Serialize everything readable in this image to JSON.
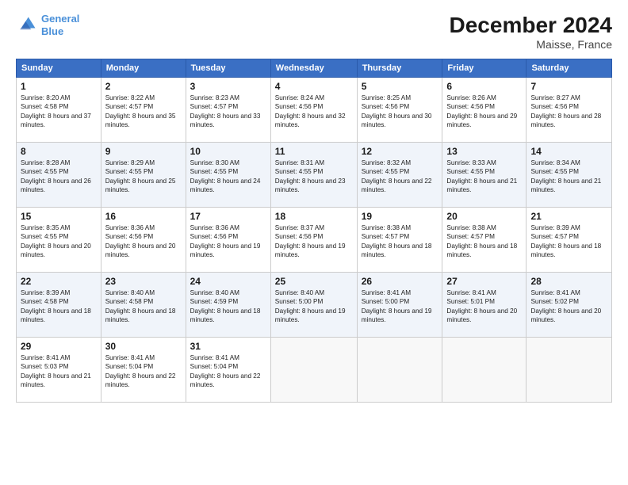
{
  "header": {
    "logo_line1": "General",
    "logo_line2": "Blue",
    "month": "December 2024",
    "location": "Maisse, France"
  },
  "weekdays": [
    "Sunday",
    "Monday",
    "Tuesday",
    "Wednesday",
    "Thursday",
    "Friday",
    "Saturday"
  ],
  "weeks": [
    [
      {
        "day": "1",
        "sunrise": "8:20 AM",
        "sunset": "4:58 PM",
        "daylight": "8 hours and 37 minutes."
      },
      {
        "day": "2",
        "sunrise": "8:22 AM",
        "sunset": "4:57 PM",
        "daylight": "8 hours and 35 minutes."
      },
      {
        "day": "3",
        "sunrise": "8:23 AM",
        "sunset": "4:57 PM",
        "daylight": "8 hours and 33 minutes."
      },
      {
        "day": "4",
        "sunrise": "8:24 AM",
        "sunset": "4:56 PM",
        "daylight": "8 hours and 32 minutes."
      },
      {
        "day": "5",
        "sunrise": "8:25 AM",
        "sunset": "4:56 PM",
        "daylight": "8 hours and 30 minutes."
      },
      {
        "day": "6",
        "sunrise": "8:26 AM",
        "sunset": "4:56 PM",
        "daylight": "8 hours and 29 minutes."
      },
      {
        "day": "7",
        "sunrise": "8:27 AM",
        "sunset": "4:56 PM",
        "daylight": "8 hours and 28 minutes."
      }
    ],
    [
      {
        "day": "8",
        "sunrise": "8:28 AM",
        "sunset": "4:55 PM",
        "daylight": "8 hours and 26 minutes."
      },
      {
        "day": "9",
        "sunrise": "8:29 AM",
        "sunset": "4:55 PM",
        "daylight": "8 hours and 25 minutes."
      },
      {
        "day": "10",
        "sunrise": "8:30 AM",
        "sunset": "4:55 PM",
        "daylight": "8 hours and 24 minutes."
      },
      {
        "day": "11",
        "sunrise": "8:31 AM",
        "sunset": "4:55 PM",
        "daylight": "8 hours and 23 minutes."
      },
      {
        "day": "12",
        "sunrise": "8:32 AM",
        "sunset": "4:55 PM",
        "daylight": "8 hours and 22 minutes."
      },
      {
        "day": "13",
        "sunrise": "8:33 AM",
        "sunset": "4:55 PM",
        "daylight": "8 hours and 21 minutes."
      },
      {
        "day": "14",
        "sunrise": "8:34 AM",
        "sunset": "4:55 PM",
        "daylight": "8 hours and 21 minutes."
      }
    ],
    [
      {
        "day": "15",
        "sunrise": "8:35 AM",
        "sunset": "4:55 PM",
        "daylight": "8 hours and 20 minutes."
      },
      {
        "day": "16",
        "sunrise": "8:36 AM",
        "sunset": "4:56 PM",
        "daylight": "8 hours and 20 minutes."
      },
      {
        "day": "17",
        "sunrise": "8:36 AM",
        "sunset": "4:56 PM",
        "daylight": "8 hours and 19 minutes."
      },
      {
        "day": "18",
        "sunrise": "8:37 AM",
        "sunset": "4:56 PM",
        "daylight": "8 hours and 19 minutes."
      },
      {
        "day": "19",
        "sunrise": "8:38 AM",
        "sunset": "4:57 PM",
        "daylight": "8 hours and 18 minutes."
      },
      {
        "day": "20",
        "sunrise": "8:38 AM",
        "sunset": "4:57 PM",
        "daylight": "8 hours and 18 minutes."
      },
      {
        "day": "21",
        "sunrise": "8:39 AM",
        "sunset": "4:57 PM",
        "daylight": "8 hours and 18 minutes."
      }
    ],
    [
      {
        "day": "22",
        "sunrise": "8:39 AM",
        "sunset": "4:58 PM",
        "daylight": "8 hours and 18 minutes."
      },
      {
        "day": "23",
        "sunrise": "8:40 AM",
        "sunset": "4:58 PM",
        "daylight": "8 hours and 18 minutes."
      },
      {
        "day": "24",
        "sunrise": "8:40 AM",
        "sunset": "4:59 PM",
        "daylight": "8 hours and 18 minutes."
      },
      {
        "day": "25",
        "sunrise": "8:40 AM",
        "sunset": "5:00 PM",
        "daylight": "8 hours and 19 minutes."
      },
      {
        "day": "26",
        "sunrise": "8:41 AM",
        "sunset": "5:00 PM",
        "daylight": "8 hours and 19 minutes."
      },
      {
        "day": "27",
        "sunrise": "8:41 AM",
        "sunset": "5:01 PM",
        "daylight": "8 hours and 20 minutes."
      },
      {
        "day": "28",
        "sunrise": "8:41 AM",
        "sunset": "5:02 PM",
        "daylight": "8 hours and 20 minutes."
      }
    ],
    [
      {
        "day": "29",
        "sunrise": "8:41 AM",
        "sunset": "5:03 PM",
        "daylight": "8 hours and 21 minutes."
      },
      {
        "day": "30",
        "sunrise": "8:41 AM",
        "sunset": "5:04 PM",
        "daylight": "8 hours and 22 minutes."
      },
      {
        "day": "31",
        "sunrise": "8:41 AM",
        "sunset": "5:04 PM",
        "daylight": "8 hours and 22 minutes."
      },
      null,
      null,
      null,
      null
    ]
  ]
}
